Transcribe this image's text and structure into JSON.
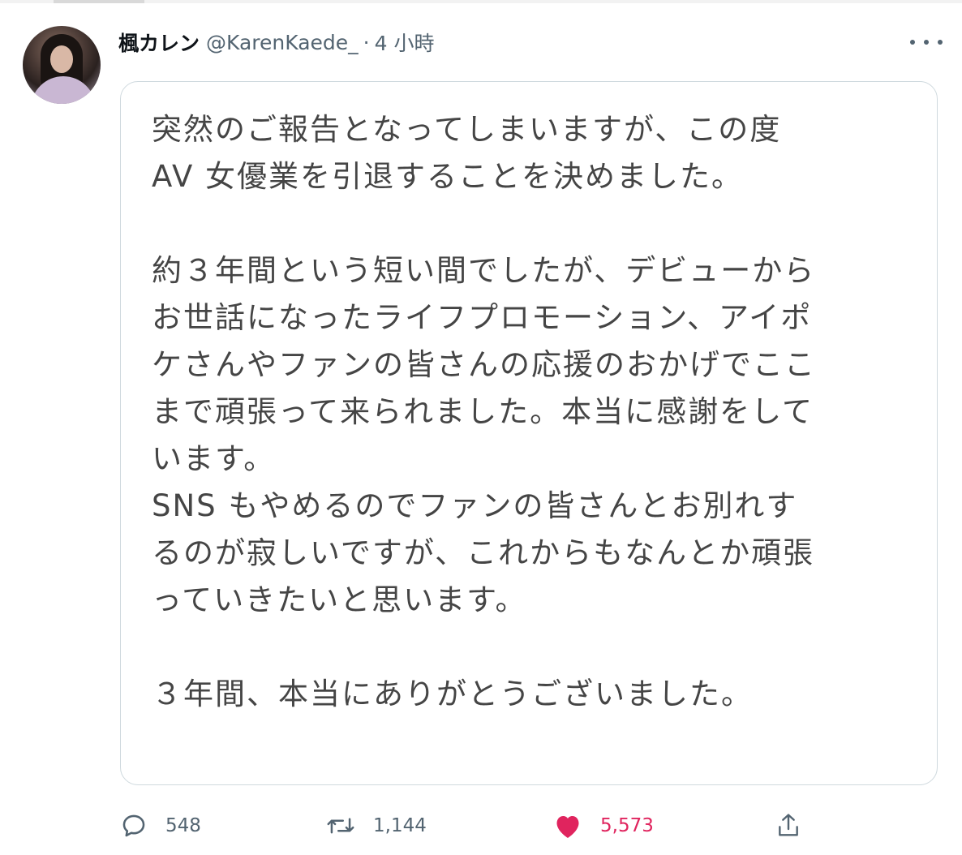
{
  "tweet": {
    "display_name": "楓カレン",
    "handle": "@KarenKaede_",
    "separator": "·",
    "time_ago": "4 小時",
    "body": {
      "paragraph_1": [
        "突然のご報告となってしまいますが、この度",
        "AV 女優業を引退することを決めました。"
      ],
      "paragraph_2": [
        "約３年間という短い間でしたが、デビューから",
        "お世話になったライフプロモーション、アイポ",
        "ケさんやファンの皆さんの応援のおかげでここ",
        "まで頑張って来られました。本当に感謝をして",
        "います。",
        "SNS もやめるのでファンの皆さんとお別れす",
        "るのが寂しいですが、これからもなんとか頑張",
        "っていきたいと思います。"
      ],
      "paragraph_3": [
        "３年間、本当にありがとうございました。"
      ]
    }
  },
  "actions": {
    "reply_count": "548",
    "retweet_count": "1,144",
    "like_count": "5,573",
    "reply_icon": "reply-icon",
    "retweet_icon": "retweet-icon",
    "like_icon": "heart-icon",
    "share_icon": "share-icon"
  },
  "colors": {
    "text_primary": "#0f1419",
    "text_secondary": "#536471",
    "body_text": "#454545",
    "like_active": "#e0245e",
    "card_border": "#cfd9de"
  }
}
